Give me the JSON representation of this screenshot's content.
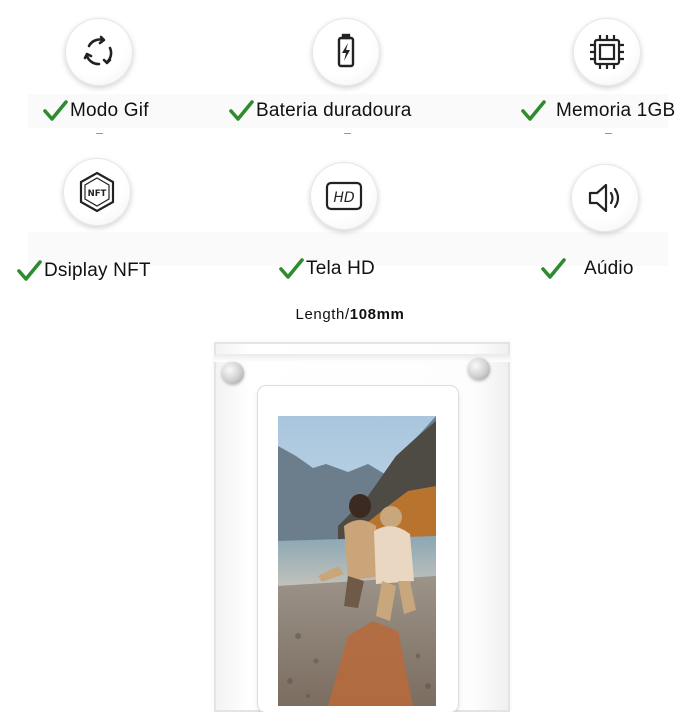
{
  "features": [
    {
      "label": "Modo Gif",
      "icon": "refresh-cycle-icon"
    },
    {
      "label": "Bateria duradoura",
      "icon": "battery-charging-icon"
    },
    {
      "label": "Memoria 1GB",
      "icon": "chip-icon"
    },
    {
      "label": "Dsiplay NFT",
      "icon": "nft-hexagon-icon"
    },
    {
      "label": "Tela HD",
      "icon": "hd-screen-icon"
    },
    {
      "label": "Aúdio",
      "icon": "speaker-icon"
    }
  ],
  "dimension": {
    "prefix": "Length/",
    "value": "108mm"
  },
  "colors": {
    "check": "#2e8b2e",
    "text": "#111111"
  }
}
